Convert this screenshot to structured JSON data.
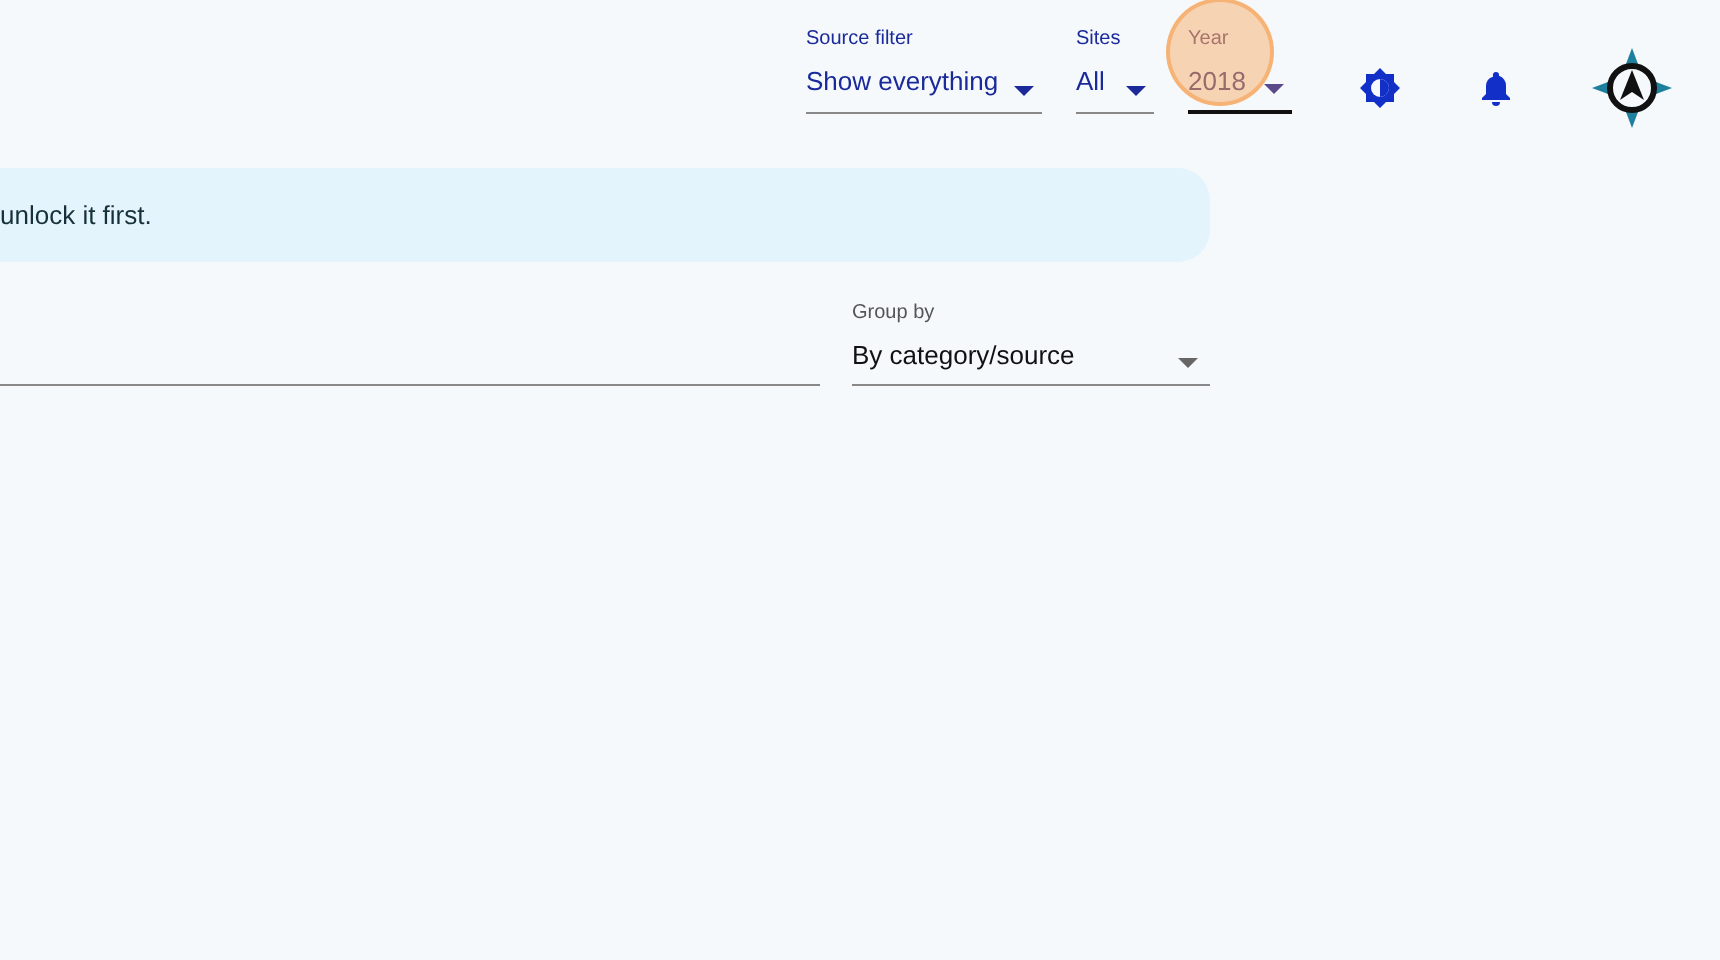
{
  "filters": [
    {
      "label": "Source filter",
      "value": "Show everything",
      "highlighted": false
    },
    {
      "label": "Sites",
      "value": "All",
      "highlighted": false
    },
    {
      "label": "Year",
      "value": "2018",
      "highlighted": true
    }
  ],
  "alert": {
    "text": "unlock it first."
  },
  "group_by": {
    "label": "Group by",
    "value": "By category/source"
  }
}
